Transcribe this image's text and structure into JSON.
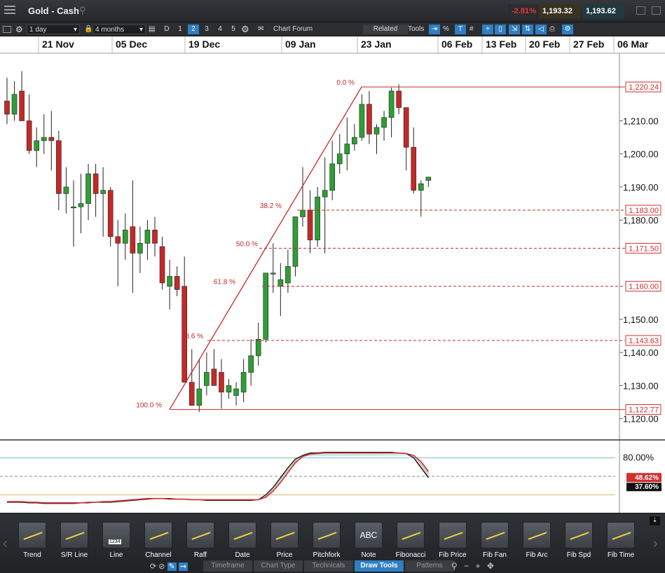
{
  "window": {
    "title": "Gold - Cash",
    "change": "-2.81%",
    "bid": "1,193.32",
    "ask": "1,193.62"
  },
  "toolbar": {
    "interval": "1 day",
    "range": "4 months",
    "buttons": [
      "D",
      "1",
      "2",
      "3",
      "4",
      "5"
    ],
    "forum": "Chart Forum",
    "related": "Related",
    "tools": "Tools"
  },
  "drawtools": [
    "Trend",
    "S/R Line",
    "Line",
    "Channel",
    "Raff",
    "Date",
    "Price",
    "Pitchfork",
    "Note",
    "Fibonacci",
    "Fib Price",
    "Fib Fan",
    "Fib Arc",
    "Fib Spd",
    "Fib Time"
  ],
  "note_icon": "ABC",
  "line_icon": "1234",
  "bottom_tabs": [
    "Timeframe",
    "Chart Type",
    "Technicals",
    "Draw Tools",
    "Patterns"
  ],
  "chart_data": {
    "type": "candlestick",
    "x_labels": [
      "21 Nov",
      "05 Dec",
      "19 Dec",
      "09 Jan",
      "23 Jan",
      "06 Feb",
      "13 Feb",
      "20 Feb",
      "27 Feb",
      "06 Mar"
    ],
    "y_ticks": [
      "1,210.00",
      "1,200.00",
      "1,190.00",
      "1,180.00",
      "1,150.00",
      "1,140.00",
      "1,130.00",
      "1,120.00"
    ],
    "ylim": [
      1114,
      1230
    ],
    "price_tags": [
      "1,220.24",
      "1,183.00",
      "1,171.50",
      "1,160.00",
      "1,143.63",
      "1,122.77"
    ],
    "fib_labels": [
      "0.0 %",
      "38.2 %",
      "50.0 %",
      "61.8 %",
      "78.6 %",
      "100.0 %"
    ],
    "fib_levels": [
      1220.24,
      1183.0,
      1171.5,
      1160.0,
      1143.63,
      1122.77
    ],
    "candles": [
      [
        1216,
        1223,
        1209,
        1212
      ],
      [
        1212,
        1222,
        1210,
        1218
      ],
      [
        1219,
        1225,
        1212,
        1210
      ],
      [
        1210,
        1218,
        1200,
        1201
      ],
      [
        1201,
        1208,
        1196,
        1204
      ],
      [
        1204,
        1212,
        1200,
        1205
      ],
      [
        1205,
        1213,
        1195,
        1204
      ],
      [
        1204,
        1207,
        1183,
        1188
      ],
      [
        1188,
        1196,
        1182,
        1190
      ],
      [
        1184,
        1192,
        1172,
        1184
      ],
      [
        1184,
        1194,
        1176,
        1185
      ],
      [
        1185,
        1197,
        1180,
        1194
      ],
      [
        1194,
        1197,
        1181,
        1188
      ],
      [
        1188,
        1196,
        1175,
        1189
      ],
      [
        1189,
        1190,
        1172,
        1175
      ],
      [
        1175,
        1180,
        1160,
        1173
      ],
      [
        1173,
        1182,
        1168,
        1177
      ],
      [
        1178,
        1192,
        1158,
        1170
      ],
      [
        1170,
        1178,
        1164,
        1173
      ],
      [
        1173,
        1180,
        1168,
        1177
      ],
      [
        1177,
        1181,
        1169,
        1173
      ],
      [
        1172,
        1175,
        1159,
        1161
      ],
      [
        1160,
        1168,
        1153,
        1163
      ],
      [
        1163,
        1166,
        1157,
        1159
      ],
      [
        1160,
        1169,
        1150,
        1131
      ],
      [
        1131,
        1141,
        1125,
        1124
      ],
      [
        1124,
        1138,
        1122,
        1129
      ],
      [
        1130,
        1140,
        1127,
        1134
      ],
      [
        1135,
        1141,
        1130,
        1130
      ],
      [
        1134,
        1138,
        1123,
        1128
      ],
      [
        1128,
        1132,
        1126,
        1130
      ],
      [
        1127,
        1131,
        1124,
        1129
      ],
      [
        1128,
        1138,
        1125,
        1134
      ],
      [
        1134,
        1144,
        1130,
        1139
      ],
      [
        1139,
        1149,
        1136,
        1144
      ],
      [
        1144,
        1163,
        1143,
        1164
      ],
      [
        1164,
        1173,
        1158,
        1164
      ],
      [
        1160,
        1167,
        1151,
        1162
      ],
      [
        1161,
        1171,
        1158,
        1166
      ],
      [
        1166,
        1180,
        1163,
        1181
      ],
      [
        1181,
        1196,
        1178,
        1183
      ],
      [
        1183,
        1189,
        1170,
        1174
      ],
      [
        1174,
        1190,
        1172,
        1187
      ],
      [
        1187,
        1199,
        1170,
        1189
      ],
      [
        1189,
        1204,
        1186,
        1197
      ],
      [
        1197,
        1206,
        1194,
        1200
      ],
      [
        1200,
        1211,
        1195,
        1203
      ],
      [
        1203,
        1209,
        1201,
        1205
      ],
      [
        1205,
        1218,
        1204,
        1215
      ],
      [
        1215,
        1219,
        1203,
        1206
      ],
      [
        1206,
        1209,
        1200,
        1208
      ],
      [
        1208,
        1213,
        1204,
        1211
      ],
      [
        1211,
        1220,
        1205,
        1219
      ],
      [
        1219,
        1221,
        1212,
        1214
      ],
      [
        1214,
        1214,
        1195,
        1202
      ],
      [
        1202,
        1208,
        1188,
        1189
      ],
      [
        1189,
        1192,
        1181,
        1191
      ],
      [
        1192,
        1193,
        1190,
        1193
      ]
    ],
    "oscillator": {
      "levels": [
        "80.00%",
        "48.62%",
        "37.60%"
      ],
      "k": [
        8,
        8,
        8,
        7,
        7,
        6,
        6,
        6,
        6,
        6,
        7,
        7,
        8,
        8,
        8,
        9,
        10,
        11,
        12,
        13,
        14,
        14,
        14,
        13,
        13,
        12,
        12,
        11,
        11,
        11,
        11,
        11,
        11,
        11,
        12,
        20,
        32,
        48,
        64,
        78,
        84,
        88,
        88,
        89,
        89,
        89,
        89,
        89,
        89,
        89,
        89,
        89,
        89,
        88,
        87,
        80,
        64,
        48
      ],
      "d": [
        9,
        9,
        9,
        8,
        8,
        7,
        7,
        7,
        7,
        7,
        7,
        8,
        8,
        9,
        9,
        10,
        11,
        12,
        13,
        14,
        14,
        14,
        13,
        13,
        13,
        12,
        12,
        12,
        12,
        12,
        12,
        12,
        12,
        12,
        12,
        16,
        26,
        40,
        56,
        72,
        82,
        86,
        87,
        88,
        88,
        88,
        88,
        88,
        88,
        88,
        88,
        88,
        88,
        88,
        87,
        84,
        74,
        58
      ],
      "colors": {
        "k": "#111111",
        "d": "#d32f2f",
        "fill_above": "#bfe1e8",
        "fill_below": "#f3d3c9"
      }
    },
    "colors": {
      "up": "#2e9e35",
      "down": "#c62828",
      "fib": "#c62828",
      "tag": "#d32f2f"
    }
  }
}
